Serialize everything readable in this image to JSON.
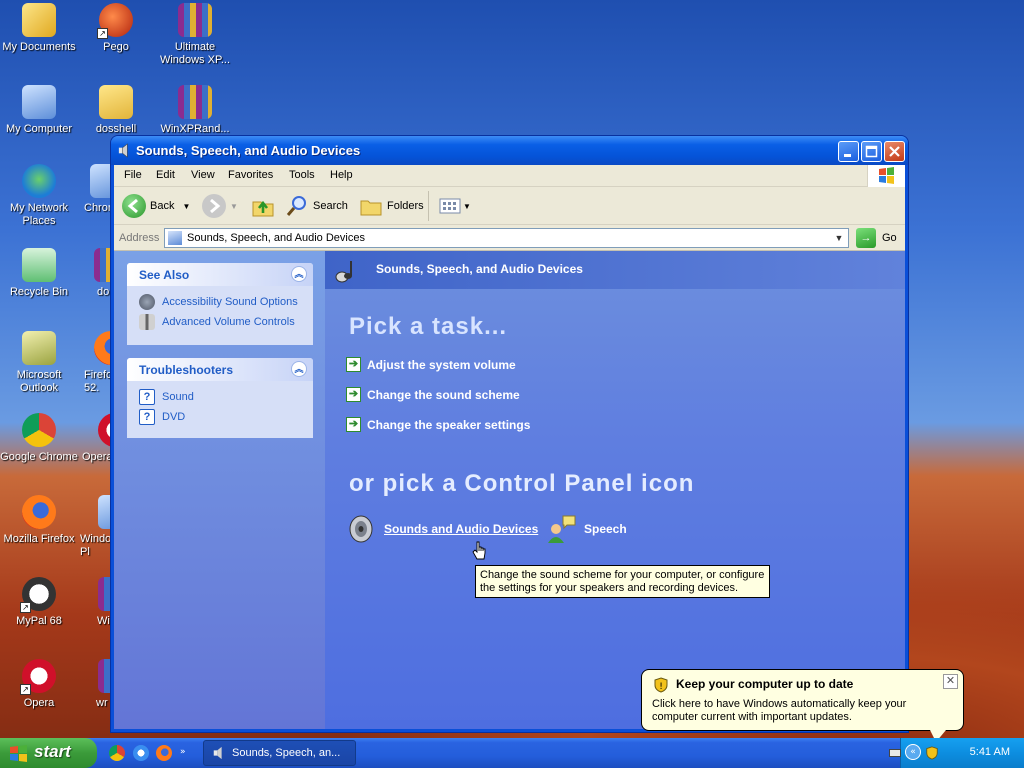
{
  "desktop": {
    "icons": [
      {
        "label": "My Documents",
        "icon": "my-documents-icon"
      },
      {
        "label": "Pego",
        "icon": "pego-icon"
      },
      {
        "label": "Ultimate Windows XP...",
        "icon": "winrar-archive-icon"
      },
      {
        "label": "My Computer",
        "icon": "my-computer-icon"
      },
      {
        "label": "dosshell",
        "icon": "folder-icon"
      },
      {
        "label": "WinXPRand...",
        "icon": "winrar-archive-icon"
      },
      {
        "label": "My Network Places",
        "icon": "network-places-icon"
      },
      {
        "label": "Chrom",
        "icon": "partial-icon"
      },
      {
        "label": "Recycle Bin",
        "icon": "recycle-bin-icon"
      },
      {
        "label": "do",
        "icon": "partial-icon"
      },
      {
        "label": "Microsoft Outlook",
        "icon": "outlook-icon"
      },
      {
        "label": "Firefo 52.",
        "icon": "partial-icon"
      },
      {
        "label": "Google Chrome",
        "icon": "chrome-icon"
      },
      {
        "label": "Opera",
        "icon": "partial-icon"
      },
      {
        "label": "Mozilla Firefox",
        "icon": "firefox-icon"
      },
      {
        "label": "Windo Pl",
        "icon": "partial-icon"
      },
      {
        "label": "MyPal 68",
        "icon": "mypal-icon"
      },
      {
        "label": "Wi",
        "icon": "partial-icon"
      },
      {
        "label": "Opera",
        "icon": "opera-icon"
      },
      {
        "label": "wr",
        "icon": "partial-icon"
      }
    ]
  },
  "window": {
    "title": "Sounds, Speech, and Audio Devices",
    "menu": [
      "File",
      "Edit",
      "View",
      "Favorites",
      "Tools",
      "Help"
    ],
    "toolbar": {
      "back_label": "Back",
      "search_label": "Search",
      "folders_label": "Folders"
    },
    "address": {
      "label": "Address",
      "value": "Sounds, Speech, and Audio Devices",
      "go_label": "Go"
    },
    "see_also": {
      "title": "See Also",
      "items": [
        "Accessibility Sound Options",
        "Advanced Volume Controls"
      ]
    },
    "troubleshooters": {
      "title": "Troubleshooters",
      "items": [
        "Sound",
        "DVD"
      ]
    },
    "category_title": "Sounds, Speech, and Audio Devices",
    "pick_task_heading": "Pick a task...",
    "tasks": [
      "Adjust the system volume",
      "Change the sound scheme",
      "Change the speaker settings"
    ],
    "pick_icon_heading": "or pick a Control Panel icon",
    "cp_icons": [
      "Sounds and Audio Devices",
      "Speech"
    ]
  },
  "tooltip": {
    "text": "Change the sound scheme for your computer, or configure the settings for your speakers and recording devices."
  },
  "balloon": {
    "title": "Keep your computer up to date",
    "text": "Click here to have Windows automatically keep your computer current with important updates."
  },
  "taskbar": {
    "start_label": "start",
    "task_label": "Sounds, Speech, an...",
    "clock": "5:41 AM"
  }
}
